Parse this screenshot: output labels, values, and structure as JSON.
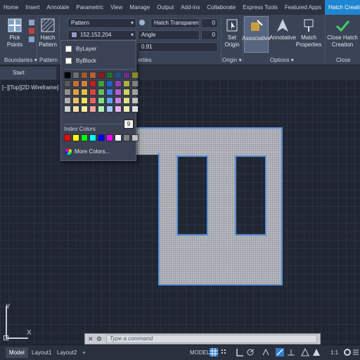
{
  "ribbon_tabs": [
    {
      "label": "Home",
      "active": false
    },
    {
      "label": "Insert",
      "active": false
    },
    {
      "label": "Annotate",
      "active": false
    },
    {
      "label": "Parametric",
      "active": false
    },
    {
      "label": "View",
      "active": false
    },
    {
      "label": "Manage",
      "active": false
    },
    {
      "label": "Output",
      "active": false
    },
    {
      "label": "Add-ins",
      "active": false
    },
    {
      "label": "Collaborate",
      "active": false
    },
    {
      "label": "Express Tools",
      "active": false
    },
    {
      "label": "Featured Apps",
      "active": false
    },
    {
      "label": "Hatch Creation",
      "active": true
    }
  ],
  "ribbon": {
    "pick_points": "Pick Points",
    "hatch_pattern": "Hatch Pattern",
    "pattern_type": "Pattern",
    "color_value": "152,152,204",
    "hatch_transparency": "Hatch Transparency",
    "transparency_value": "0",
    "angle": "Angle",
    "angle_value": "0",
    "scale_value": "0.91",
    "properties": "erties",
    "set_origin": "Set Origin",
    "associative": "Associative",
    "annotative": "Annotative",
    "match_properties": "Match Properties",
    "close_hatch": "Close Hatch Creation",
    "panels": {
      "boundaries": "Boundaries",
      "pattern": "Pattern",
      "origin": "Origin",
      "options": "Options",
      "close": "Close"
    }
  },
  "file_tab": "Start",
  "viewport_label": "[−][Top][2D Wireframe]",
  "color_dropdown": {
    "by_layer": "ByLayer",
    "by_block": "ByBlock",
    "index_colors_label": "Index Colors",
    "more_colors": "More Colors...",
    "tooltip": "9",
    "palette": [
      "#000000",
      "#6e6e6e",
      "#a05a2c",
      "#b8603a",
      "#8a1c1c",
      "#2a6e2a",
      "#1e4f8c",
      "#6a2c8a",
      "#8a8a2a",
      "#5a5a5a",
      "#c07030",
      "#d08040",
      "#c02020",
      "#40a040",
      "#2060c0",
      "#9040b0",
      "#b0b040",
      "#808080",
      "#909090",
      "#e0a040",
      "#e0c040",
      "#e04040",
      "#60c060",
      "#4080e0",
      "#b060d0",
      "#d0d060",
      "#a0a0a0",
      "#b0b0b0",
      "#f0c060",
      "#f0e060",
      "#f06060",
      "#80e080",
      "#60a0f0",
      "#d080e0",
      "#e0e080",
      "#c0c0c0",
      "#d0d0d0",
      "#f8e0a0",
      "#f8f0a0",
      "#f8a0a0",
      "#b0f0b0",
      "#a0c8f8",
      "#e8b0f0",
      "#f0f0b0",
      "#e0e0e0"
    ],
    "index_row": [
      "#ff0000",
      "#ffff00",
      "#00ff00",
      "#00ffff",
      "#0000ff",
      "#ff00ff",
      "#ffffff",
      "#808080",
      "#c0c0c0"
    ]
  },
  "ucs": {
    "y": "Y",
    "x": "X"
  },
  "command": {
    "placeholder": "Type a command"
  },
  "status": {
    "layouts": [
      {
        "label": "Model",
        "active": true
      },
      {
        "label": "Layout1",
        "active": false
      },
      {
        "label": "Layout2",
        "active": false
      }
    ],
    "add_layout": "+",
    "model": "MODEL",
    "scale": "1:1"
  }
}
